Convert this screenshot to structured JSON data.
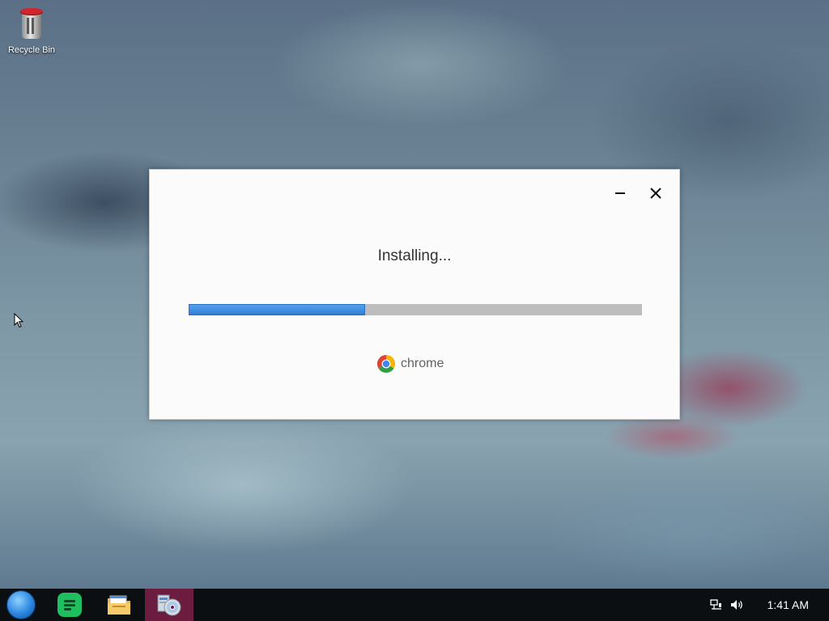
{
  "desktop": {
    "icons": [
      {
        "label": "Recycle Bin",
        "icon": "recycle-bin-icon"
      }
    ]
  },
  "installer": {
    "status_text": "Installing...",
    "progress": 0.39,
    "brand_name": "chrome",
    "minimize_icon": "minimize-icon",
    "close_icon": "close-icon",
    "progress_color": "#2f7fd6",
    "track_color": "#bdbdbd"
  },
  "taskbar": {
    "start_icon": "start-orb-icon",
    "apps": [
      {
        "name": "notes",
        "icon": "notes-app-icon",
        "active": false
      },
      {
        "name": "files",
        "icon": "file-explorer-icon",
        "active": false
      },
      {
        "name": "disc",
        "icon": "disc-installer-icon",
        "active": true
      }
    ],
    "tray": {
      "network_icon": "network-icon",
      "volume_icon": "volume-icon",
      "clock": "1:41 AM"
    },
    "active_color": "#6b1c3f"
  }
}
